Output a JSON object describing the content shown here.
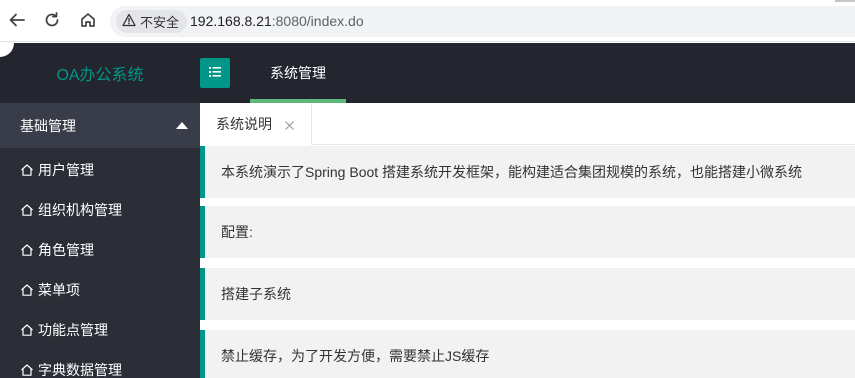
{
  "browser": {
    "security_label": "不安全",
    "url_host": "192.168.8.21",
    "url_rest": ":8080/index.do"
  },
  "header": {
    "logo": "OA办公系统",
    "menu_toggle_icon": "list-icon",
    "nav_item": "系统管理"
  },
  "sidebar": {
    "group_label": "基础管理",
    "items": [
      {
        "label": "用户管理",
        "icon": "home-icon"
      },
      {
        "label": "组织机构管理",
        "icon": "home-icon"
      },
      {
        "label": "角色管理",
        "icon": "home-icon"
      },
      {
        "label": "菜单项",
        "icon": "home-icon"
      },
      {
        "label": "功能点管理",
        "icon": "home-icon"
      },
      {
        "label": "字典数据管理",
        "icon": "home-icon"
      }
    ]
  },
  "tabs": [
    {
      "label": "系统说明",
      "closable": true
    }
  ],
  "content": {
    "blocks": [
      "本系统演示了Spring Boot 搭建系统开发框架，能构建适合集团规模的系统，也能搭建小微系统",
      "配置:",
      "搭建子系统",
      "禁止缓存，为了开发方便，需要禁止JS缓存"
    ]
  },
  "colors": {
    "accent": "#009688",
    "header_bg": "#23262e",
    "sidebar_bg": "#393d49",
    "nav_indicator": "#5fb878"
  }
}
